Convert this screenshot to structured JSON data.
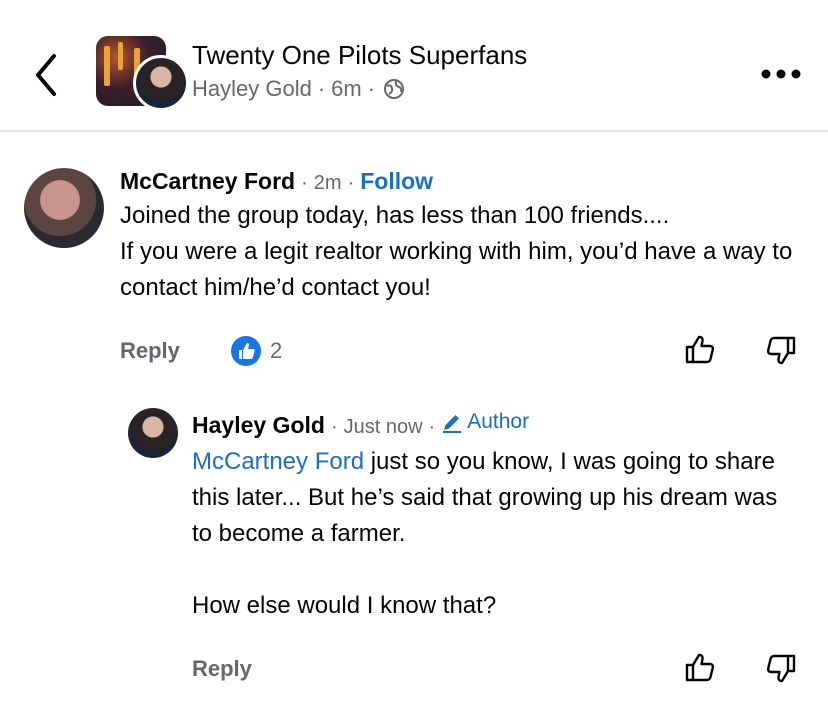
{
  "header": {
    "group_name": "Twenty One Pilots Superfans",
    "author": "Hayley Gold",
    "time": "6m",
    "separator": "·"
  },
  "comments": [
    {
      "author": "McCartney Ford",
      "time": "2m",
      "follow_label": "Follow",
      "text": "Joined the group today, has less than 100 friends....\nIf you were a legit realtor working with him, you’d have a way to contact him/he’d contact you!",
      "reply_label": "Reply",
      "reaction_count": "2"
    },
    {
      "author": "Hayley Gold",
      "time": "Just now",
      "author_badge": "Author",
      "mention": "McCartney Ford",
      "text": " just so you know, I was going to share this later... But he’s said that growing up his dream was to become a farmer.\n\nHow else would I know that?",
      "reply_label": "Reply"
    }
  ],
  "colors": {
    "link": "#1b6ec2",
    "like_badge": "#1b74e4",
    "meta": "#65676b"
  }
}
